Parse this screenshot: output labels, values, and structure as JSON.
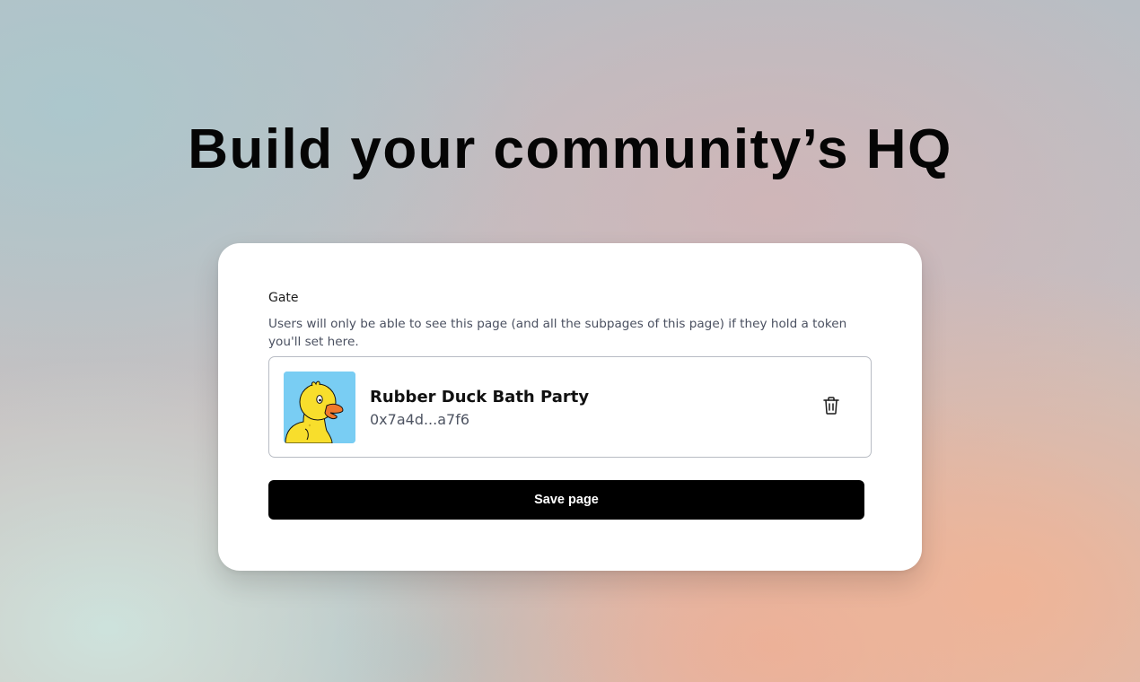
{
  "hero": {
    "title": "Build your community’s HQ"
  },
  "gate": {
    "label": "Gate",
    "description": "Users will only be able to see this page (and all the subpages of this page) if they hold a token you'll set here.",
    "token": {
      "name": "Rubber Duck Bath Party",
      "address": "0x7a4d...a7f6",
      "thumbnail_icon": "rubber-duck-image",
      "thumbnail_bg": "#79cdf3"
    },
    "delete_icon": "trash-icon"
  },
  "actions": {
    "save_label": "Save page"
  },
  "colors": {
    "button_bg": "#000000",
    "button_text": "#ffffff",
    "card_bg": "#ffffff"
  }
}
